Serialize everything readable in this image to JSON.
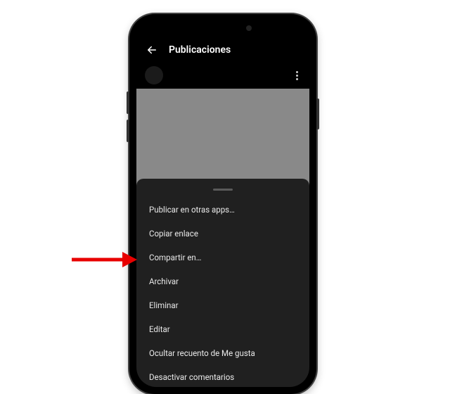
{
  "header": {
    "title": "Publicaciones"
  },
  "sheet": {
    "items": [
      "Publicar en otras apps…",
      "Copiar enlace",
      "Compartir en…",
      "Archivar",
      "Eliminar",
      "Editar",
      "Ocultar recuento de Me gusta",
      "Desactivar comentarios"
    ]
  }
}
